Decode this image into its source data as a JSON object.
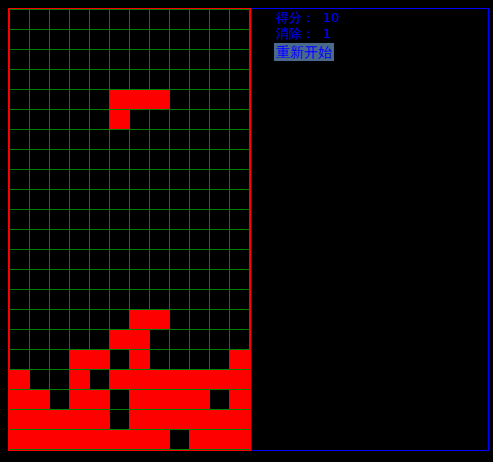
{
  "board": {
    "columns": 12,
    "rows": [
      [
        0,
        0,
        0,
        0,
        0,
        0,
        0,
        0,
        0,
        0,
        0,
        0
      ],
      [
        0,
        0,
        0,
        0,
        0,
        0,
        0,
        0,
        0,
        0,
        0,
        0
      ],
      [
        0,
        0,
        0,
        0,
        0,
        0,
        0,
        0,
        0,
        0,
        0,
        0
      ],
      [
        0,
        0,
        0,
        0,
        0,
        0,
        0,
        0,
        0,
        0,
        0,
        0
      ],
      [
        0,
        0,
        0,
        0,
        0,
        1,
        1,
        1,
        0,
        0,
        0,
        0
      ],
      [
        0,
        0,
        0,
        0,
        0,
        1,
        0,
        0,
        0,
        0,
        0,
        0
      ],
      [
        0,
        0,
        0,
        0,
        0,
        0,
        0,
        0,
        0,
        0,
        0,
        0
      ],
      [
        0,
        0,
        0,
        0,
        0,
        0,
        0,
        0,
        0,
        0,
        0,
        0
      ],
      [
        0,
        0,
        0,
        0,
        0,
        0,
        0,
        0,
        0,
        0,
        0,
        0
      ],
      [
        0,
        0,
        0,
        0,
        0,
        0,
        0,
        0,
        0,
        0,
        0,
        0
      ],
      [
        0,
        0,
        0,
        0,
        0,
        0,
        0,
        0,
        0,
        0,
        0,
        0
      ],
      [
        0,
        0,
        0,
        0,
        0,
        0,
        0,
        0,
        0,
        0,
        0,
        0
      ],
      [
        0,
        0,
        0,
        0,
        0,
        0,
        0,
        0,
        0,
        0,
        0,
        0
      ],
      [
        0,
        0,
        0,
        0,
        0,
        0,
        0,
        0,
        0,
        0,
        0,
        0
      ],
      [
        0,
        0,
        0,
        0,
        0,
        0,
        0,
        0,
        0,
        0,
        0,
        0
      ],
      [
        0,
        0,
        0,
        0,
        0,
        0,
        1,
        1,
        0,
        0,
        0,
        0
      ],
      [
        0,
        0,
        0,
        0,
        0,
        1,
        1,
        0,
        0,
        0,
        0,
        0
      ],
      [
        0,
        0,
        0,
        1,
        1,
        0,
        1,
        0,
        0,
        0,
        0,
        1
      ],
      [
        1,
        0,
        0,
        1,
        0,
        1,
        1,
        1,
        1,
        1,
        1,
        1
      ],
      [
        1,
        1,
        0,
        1,
        1,
        0,
        1,
        1,
        1,
        1,
        0,
        1
      ],
      [
        1,
        1,
        1,
        1,
        1,
        0,
        1,
        1,
        1,
        1,
        1,
        1
      ],
      [
        1,
        1,
        1,
        1,
        1,
        1,
        1,
        1,
        0,
        1,
        1,
        1
      ]
    ]
  },
  "stats": [
    {
      "label": "得分：",
      "value": "10"
    },
    {
      "label": "消除：",
      "value": "1"
    }
  ],
  "buttons": [
    "重新开始"
  ]
}
